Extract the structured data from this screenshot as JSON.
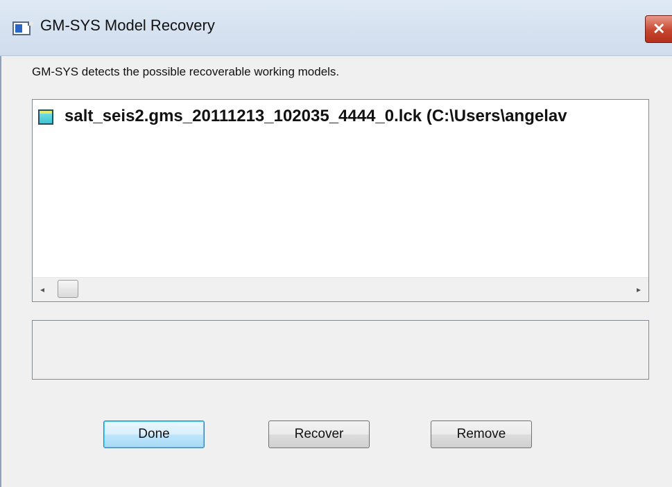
{
  "window": {
    "title": "GM-SYS Model Recovery",
    "close_symbol": "✕",
    "icon": "app-window-icon"
  },
  "description": "GM-SYS detects the possible recoverable working models.",
  "models_list": {
    "items": [
      {
        "label": "salt_seis2.gms_20111213_102035_4444_0.lck (C:\\Users\\angelav",
        "icon": "model-file-icon"
      }
    ],
    "scroll_left_symbol": "◂",
    "scroll_right_symbol": "▸"
  },
  "status_text": "",
  "buttons": {
    "done": "Done",
    "recover": "Recover",
    "remove": "Remove"
  },
  "colors": {
    "close_button": "#c8452f",
    "default_button_border": "#3c7fb1",
    "model_icon": "#3cc7cf"
  }
}
